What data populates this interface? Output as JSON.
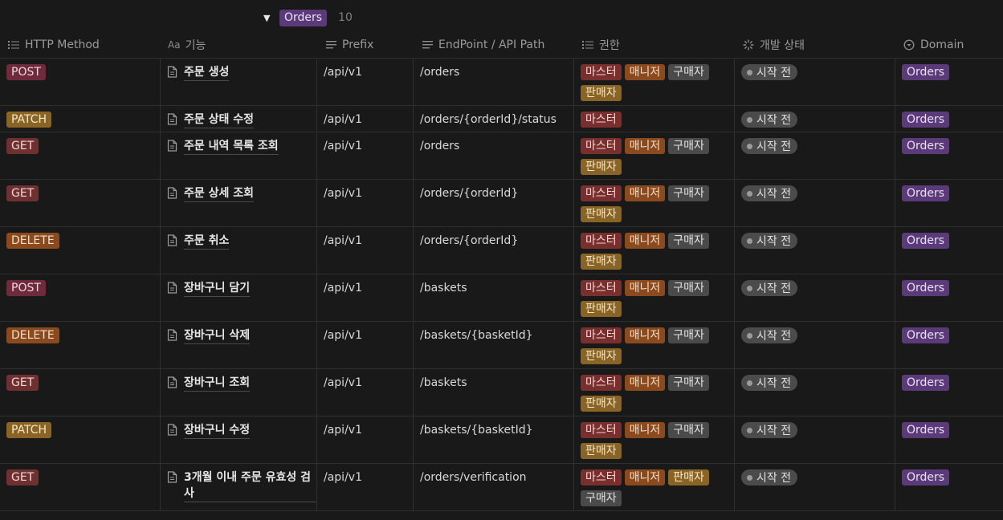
{
  "group": {
    "toggle_icon": "triangle-down-icon",
    "label": "Orders",
    "count": "10"
  },
  "columns": [
    {
      "label": "HTTP Method",
      "icon": "list-icon"
    },
    {
      "label": "기능",
      "icon": "aa-title-icon",
      "prefix": "Aa"
    },
    {
      "label": "Prefix",
      "icon": "text-lines-icon"
    },
    {
      "label": "EndPoint / API Path",
      "icon": "text-lines-icon"
    },
    {
      "label": "권한",
      "icon": "list-icon"
    },
    {
      "label": "개발 상태",
      "icon": "status-spinner-icon"
    },
    {
      "label": "Domain",
      "icon": "select-icon"
    }
  ],
  "rows": [
    {
      "method": "POST",
      "title": "주문 생성",
      "prefix": "/api/v1",
      "path": "/orders",
      "roles": [
        "마스터",
        "매니저",
        "구매자",
        "판매자"
      ],
      "status": "시작 전",
      "domain": "Orders"
    },
    {
      "method": "PATCH",
      "title": "주문 상태 수정",
      "prefix": "/api/v1",
      "path": "/orders/{orderId}/status",
      "roles": [
        "마스터"
      ],
      "status": "시작 전",
      "domain": "Orders"
    },
    {
      "method": "GET",
      "title": "주문 내역 목록 조회",
      "prefix": "/api/v1",
      "path": "/orders",
      "roles": [
        "마스터",
        "매니저",
        "구매자",
        "판매자"
      ],
      "status": "시작 전",
      "domain": "Orders"
    },
    {
      "method": "GET",
      "title": "주문 상세 조회",
      "prefix": "/api/v1",
      "path": "/orders/{orderId}",
      "roles": [
        "마스터",
        "매니저",
        "구매자",
        "판매자"
      ],
      "status": "시작 전",
      "domain": "Orders"
    },
    {
      "method": "DELETE",
      "title": "주문 취소",
      "prefix": "/api/v1",
      "path": "/orders/{orderId}",
      "roles": [
        "마스터",
        "매니저",
        "구매자",
        "판매자"
      ],
      "status": "시작 전",
      "domain": "Orders"
    },
    {
      "method": "POST",
      "title": "장바구니 담기",
      "prefix": "/api/v1",
      "path": "/baskets",
      "roles": [
        "마스터",
        "매니저",
        "구매자",
        "판매자"
      ],
      "status": "시작 전",
      "domain": "Orders"
    },
    {
      "method": "DELETE",
      "title": "장바구니 삭제",
      "prefix": "/api/v1",
      "path": "/baskets/{basketId}",
      "roles": [
        "마스터",
        "매니저",
        "구매자",
        "판매자"
      ],
      "status": "시작 전",
      "domain": "Orders"
    },
    {
      "method": "GET",
      "title": "장바구니 조회",
      "prefix": "/api/v1",
      "path": "/baskets",
      "roles": [
        "마스터",
        "매니저",
        "구매자",
        "판매자"
      ],
      "status": "시작 전",
      "domain": "Orders"
    },
    {
      "method": "PATCH",
      "title": "장바구니 수정",
      "prefix": "/api/v1",
      "path": "/baskets/{basketId}",
      "roles": [
        "마스터",
        "매니저",
        "구매자",
        "판매자"
      ],
      "status": "시작 전",
      "domain": "Orders"
    },
    {
      "method": "GET",
      "title": "3개월 이내 주문 유효성 검사",
      "prefix": "/api/v1",
      "path": "/orders/verification",
      "roles": [
        "마스터",
        "매니저",
        "판매자",
        "구매자"
      ],
      "status": "시작 전",
      "domain": "Orders"
    }
  ],
  "colors": {
    "background": "#191919",
    "method_post": "#6e2b3e",
    "method_patch": "#8a6424",
    "method_get": "#6e3030",
    "method_delete": "#8a4a1e",
    "role_master": "#7a2f2f",
    "role_manager": "#8a4a1e",
    "role_buyer": "#4a4a4a",
    "role_seller": "#8a6424",
    "domain_orders": "#5a3a78",
    "status_pill": "#4b4b4b"
  }
}
